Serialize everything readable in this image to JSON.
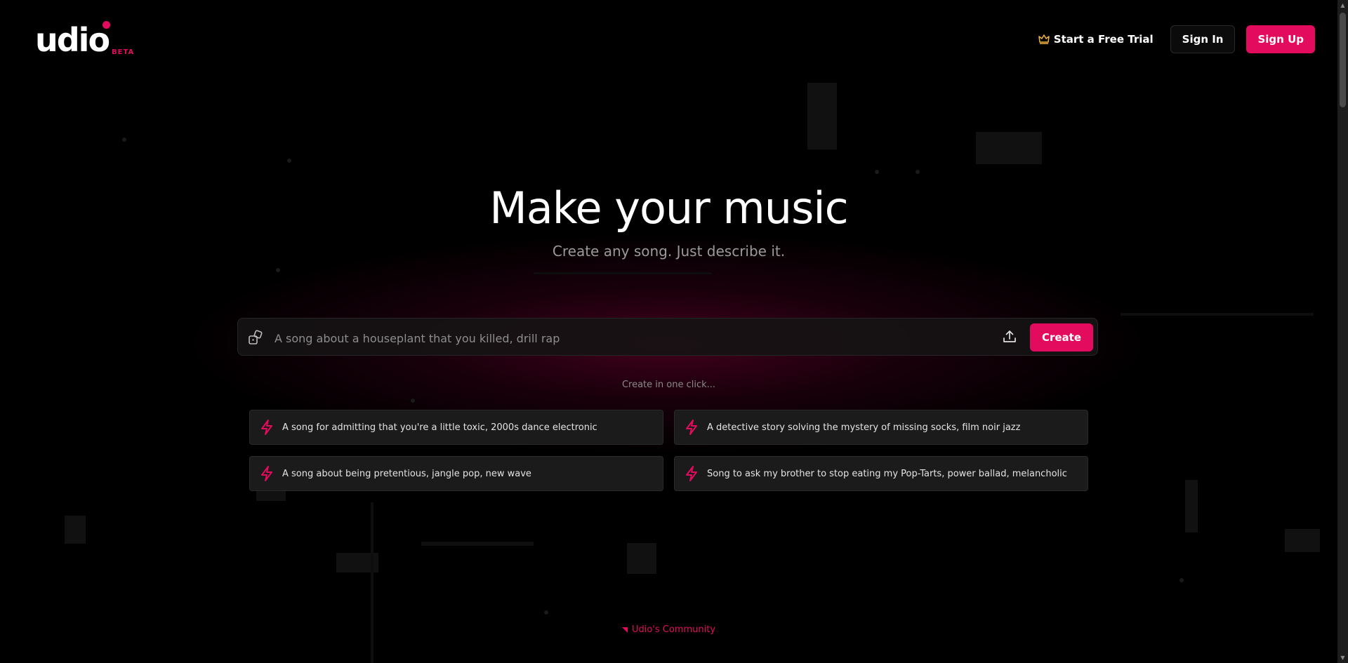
{
  "brand": {
    "name": "udio",
    "badge": "BETA",
    "accent_color": "#e30b5d"
  },
  "nav": {
    "trial_label": "Start a Free Trial",
    "trial_icon": "crown-icon",
    "signin_label": "Sign In",
    "signup_label": "Sign Up"
  },
  "hero": {
    "title": "Make your music",
    "subtitle": "Create any song. Just describe it."
  },
  "prompt": {
    "placeholder": "A song about a houseplant that you killed, drill rap",
    "value": "",
    "create_label": "Create",
    "left_icon": "dice-icon",
    "right_icon": "upload-icon"
  },
  "suggestions": {
    "heading": "Create in one click...",
    "items": [
      {
        "label": "A song for admitting that you're a little toxic, 2000s dance electronic",
        "icon": "bolt-icon"
      },
      {
        "label": "A detective story solving the mystery of missing socks, film noir jazz",
        "icon": "bolt-icon"
      },
      {
        "label": "A song about being pretentious, jangle pop, new wave",
        "icon": "bolt-icon"
      },
      {
        "label": "Song to ask my brother to stop eating my Pop-Tarts, power ballad, melancholic",
        "icon": "bolt-icon"
      }
    ]
  },
  "community": {
    "label": "Udio's Community"
  }
}
